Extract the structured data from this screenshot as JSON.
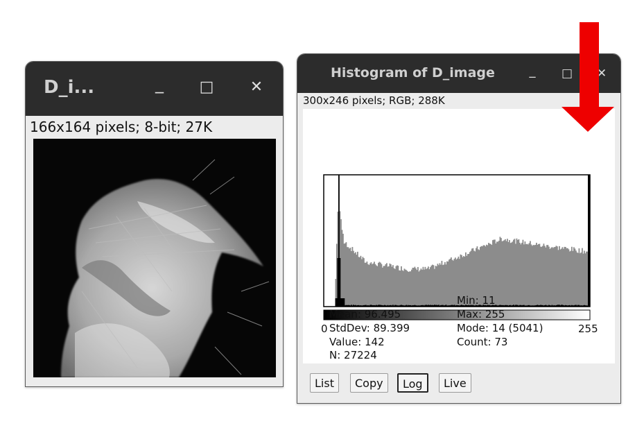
{
  "image_window": {
    "title": "D_i...",
    "info": "166x164 pixels; 8-bit; 27K",
    "controls": {
      "minimize": "_",
      "maximize": "□",
      "close": "✕"
    }
  },
  "histogram_window": {
    "title": "Histogram of D_image",
    "info": "300x246 pixels; RGB; 288K",
    "controls": {
      "minimize": "_",
      "maximize": "□",
      "close": "✕"
    },
    "axis": {
      "min_label": "0",
      "max_label": "255"
    },
    "stats": {
      "n": "N: 27224",
      "mean": "Mean: 96.495",
      "stddev": "StdDev: 89.399",
      "value": "Value: 142",
      "min": "Min: 11",
      "max": "Max: 255",
      "mode": "Mode: 14 (5041)",
      "count": "Count: 73"
    },
    "buttons": {
      "list": "List",
      "copy": "Copy",
      "log": "Log",
      "live": "Live"
    }
  },
  "colors": {
    "arrow": "#ee0000",
    "titlebar": "#2c2c2c",
    "histogram_log": "#8c8c8c",
    "histogram_linear": "#000000"
  }
}
